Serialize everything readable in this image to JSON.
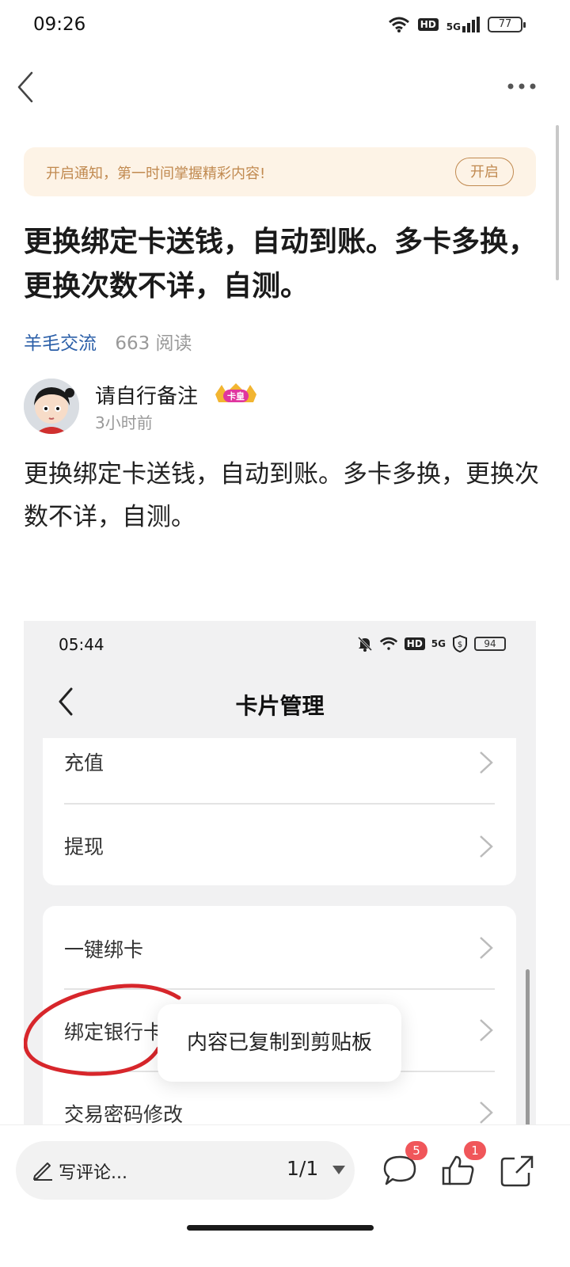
{
  "status_bar": {
    "time": "09:26",
    "battery": "77",
    "icons": [
      "wifi-icon",
      "hd-icon",
      "signal-5g-icon",
      "battery-icon"
    ],
    "hd_label": "HD",
    "network_label": "5G"
  },
  "nav": {
    "icons": [
      "back-icon",
      "more-icon"
    ]
  },
  "notice": {
    "text": "开启通知，第一时间掌握精彩内容!",
    "button": "开启"
  },
  "article": {
    "title": "更换绑定卡送钱，自动到账。多卡多换，更换次数不详，自测。",
    "category": "羊毛交流",
    "reads": "663 阅读",
    "author": {
      "name": "请自行备注",
      "badge": "卡皇",
      "time": "3小时前"
    },
    "body": "更换绑定卡送钱，自动到账。多卡多换，更换次数不详，自测。"
  },
  "embedded_screenshot": {
    "status_time": "05:44",
    "battery": "94",
    "hd_label": "HD",
    "network_label": "5G",
    "title": "卡片管理",
    "card1": [
      {
        "label": "充值"
      },
      {
        "label": "提现"
      }
    ],
    "card2": [
      {
        "label": "一键绑卡"
      },
      {
        "label": "绑定银行卡"
      },
      {
        "label": "交易密码修改"
      }
    ],
    "toast": "内容已复制到剪贴板",
    "colors": {
      "annotation": "#d7262b"
    }
  },
  "bottom_bar": {
    "comment_placeholder": "写评论...",
    "page_indicator": "1/1",
    "comment_count": "5",
    "like_count": "1",
    "icons": [
      "pen-icon",
      "dropdown-icon",
      "comment-icon",
      "like-icon",
      "share-icon"
    ]
  },
  "colors": {
    "accent_link": "#2b5fa8",
    "notice_text": "#c18a50",
    "notice_bg": "#fdf3e6",
    "badge_red": "#f0565a"
  }
}
